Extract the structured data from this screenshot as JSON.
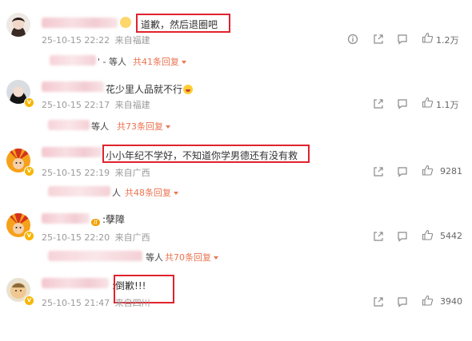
{
  "comments": [
    {
      "text": "道歉，然后退圈吧",
      "time": "25-10-15 22:22",
      "location": "来自福建",
      "reply_suffix": "等人",
      "reply_link": "共41条回复",
      "likes": "1.2万"
    },
    {
      "text": "花少里人品就不行",
      "time": "25-10-15 22:17",
      "location": "来自福建",
      "reply_suffix": "等人",
      "reply_link": "共73条回复",
      "likes": "1.1万"
    },
    {
      "text": "小小年纪不学好，不知道你学男德还有没有救",
      "time": "25-10-15 22:19",
      "location": "来自广西",
      "reply_suffix": "人",
      "reply_link": "共48条回复",
      "likes": "9281"
    },
    {
      "text": ":孽障",
      "time": "25-10-15 22:20",
      "location": "来自广西",
      "reply_suffix": "等人",
      "reply_link": "共70条回复",
      "likes": "5442"
    },
    {
      "text": ":倒歉!!!",
      "time": "25-10-15 21:47",
      "location": "来自四川",
      "reply_suffix": "",
      "reply_link": "",
      "likes": "3940"
    }
  ],
  "colors": {
    "highlight": "#e0232d",
    "reply_link": "#eb7350",
    "meta": "#9a9a9a"
  },
  "icons": [
    "info-icon",
    "share-icon",
    "comment-icon",
    "like-icon"
  ]
}
